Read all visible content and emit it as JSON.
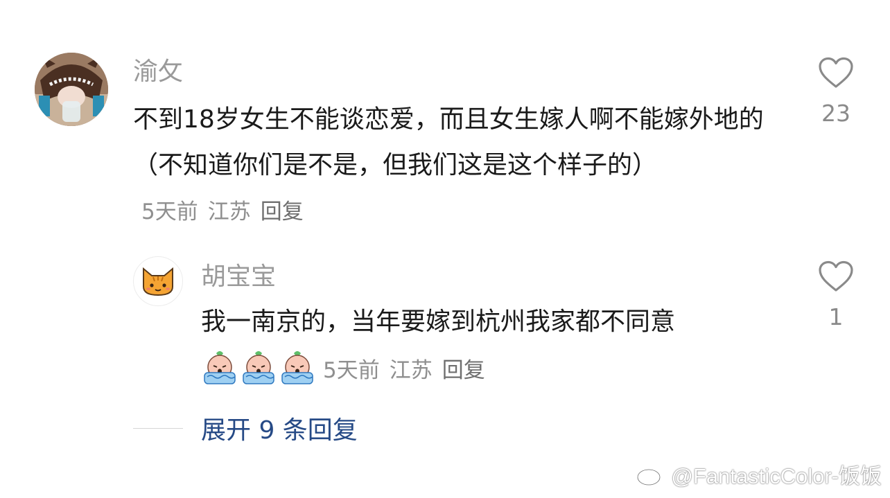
{
  "comments": [
    {
      "username": "渝攵",
      "text": "不到18岁女生不能谈恋爱，而且女生嫁人啊不能嫁外地的（不知道你们是不是，但我们这是这个样子的）",
      "time": "5天前",
      "location": "江苏",
      "reply_label": "回复",
      "like_count": "23",
      "avatar_icon": "photo-avatar"
    }
  ],
  "replies": [
    {
      "username": "胡宝宝",
      "text": "我一南京的，当年要嫁到杭州我家都不同意",
      "emojis": [
        "crying-emoji",
        "crying-emoji",
        "crying-emoji"
      ],
      "time": "5天前",
      "location": "江苏",
      "reply_label": "回复",
      "like_count": "1",
      "avatar_icon": "cat-avatar"
    }
  ],
  "expand": {
    "label": "展开 9 条回复"
  },
  "watermark": {
    "text": "@FantasticColor-饭饭",
    "icon": "weibo-logo"
  },
  "colors": {
    "link": "#264a86",
    "muted": "#9a9a9a",
    "text": "#1a1a1a"
  }
}
